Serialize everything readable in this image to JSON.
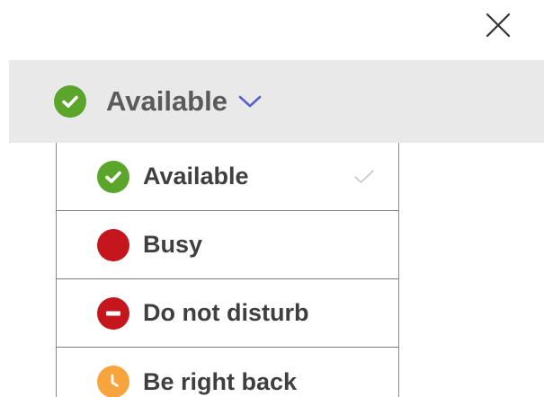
{
  "current_status": {
    "label": "Available",
    "color": "#5aa52a"
  },
  "menu": {
    "items": [
      {
        "label": "Available",
        "icon": "check-circle-icon",
        "color": "#5aa52a",
        "selected": true
      },
      {
        "label": "Busy",
        "icon": "filled-circle-icon",
        "color": "#c4161c",
        "selected": false
      },
      {
        "label": "Do not disturb",
        "icon": "minus-circle-icon",
        "color": "#c4161c",
        "selected": false
      },
      {
        "label": "Be right back",
        "icon": "clock-circle-icon",
        "color": "#f7a43d",
        "selected": false
      }
    ]
  },
  "colors": {
    "chevron": "#5b5fc7",
    "bar_background": "#e9e9e9",
    "check_mark": "#c8c8c8"
  }
}
